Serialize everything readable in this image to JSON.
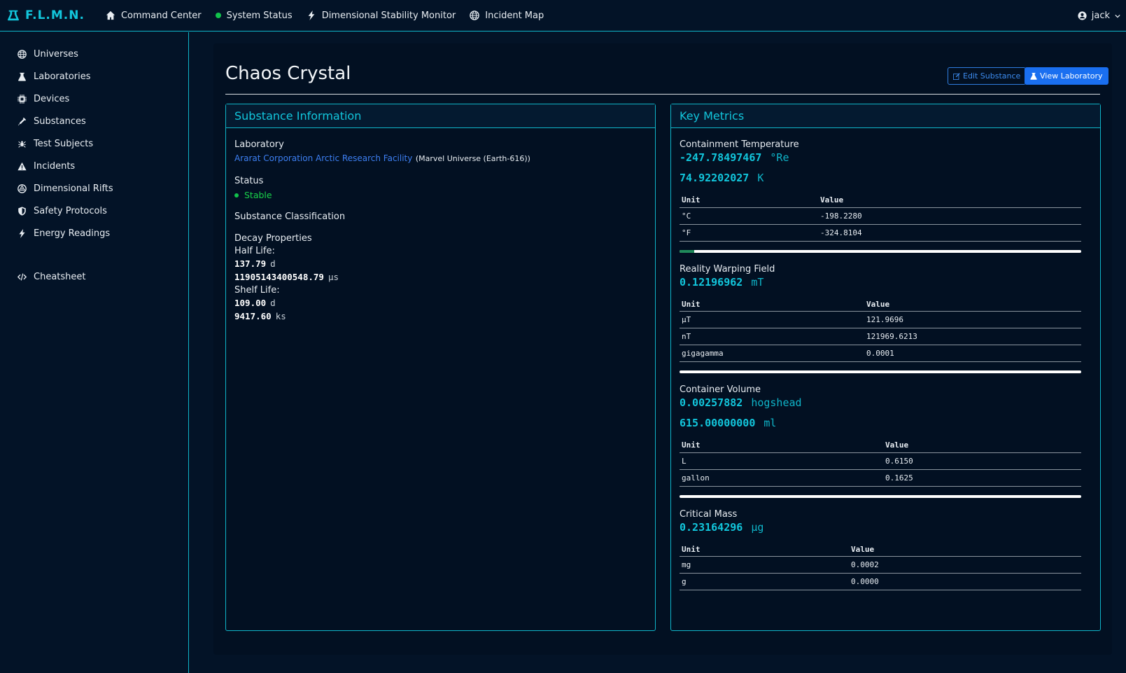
{
  "brand": {
    "name": "F.L.M.N.",
    "icon": "flask-icon"
  },
  "topnav": {
    "links": [
      {
        "label": "Command Center",
        "icon": "home-icon"
      },
      {
        "label": "System Status",
        "icon": "status-dot"
      },
      {
        "label": "Dimensional Stability Monitor",
        "icon": "bolt-icon"
      },
      {
        "label": "Incident Map",
        "icon": "globe-icon"
      }
    ],
    "user": "jack"
  },
  "sidebar": {
    "items": [
      {
        "label": "Universes",
        "icon": "globe-icon"
      },
      {
        "label": "Laboratories",
        "icon": "flask-icon"
      },
      {
        "label": "Devices",
        "icon": "chip-icon"
      },
      {
        "label": "Substances",
        "icon": "syringe-icon"
      },
      {
        "label": "Test Subjects",
        "icon": "spider-icon"
      },
      {
        "label": "Incidents",
        "icon": "warning-icon"
      },
      {
        "label": "Dimensional Rifts",
        "icon": "atom-icon"
      },
      {
        "label": "Safety Protocols",
        "icon": "shield-icon"
      },
      {
        "label": "Energy Readings",
        "icon": "bolt-icon"
      }
    ],
    "cheatsheet": {
      "label": "Cheatsheet",
      "icon": "code-icon"
    }
  },
  "page": {
    "title": "Chaos Crystal",
    "edit_label": "Edit Substance",
    "view_label": "View Laboratory"
  },
  "info": {
    "heading": "Substance Information",
    "laboratory_label": "Laboratory",
    "laboratory_link": "Ararat Corporation Arctic Research Facility",
    "laboratory_universe": "(Marvel Universe (Earth-616))",
    "status_label": "Status",
    "status_value": "Stable",
    "classification_label": "Substance Classification",
    "decay_label": "Decay Properties",
    "half_life_label": "Half Life:",
    "half_life": [
      {
        "value": "137.79",
        "unit": "d"
      },
      {
        "value": "11905143400548.79",
        "unit": "μs"
      }
    ],
    "shelf_life_label": "Shelf Life:",
    "shelf_life": [
      {
        "value": "109.00",
        "unit": "d"
      },
      {
        "value": "9417.60",
        "unit": "ks"
      }
    ]
  },
  "metrics": {
    "heading": "Key Metrics",
    "col_unit": "Unit",
    "col_value": "Value",
    "temperature": {
      "name": "Containment Temperature",
      "primary": [
        {
          "value": "-247.78497467",
          "unit": "°Re"
        },
        {
          "value": "74.92202027",
          "unit": "K"
        }
      ],
      "rows": [
        {
          "unit": "°C",
          "value": "-198.2280"
        },
        {
          "unit": "°F",
          "value": "-324.8104"
        }
      ],
      "progress": 0.037
    },
    "field": {
      "name": "Reality Warping Field",
      "primary": [
        {
          "value": "0.12196962",
          "unit": "mT"
        }
      ],
      "rows": [
        {
          "unit": "μT",
          "value": "121.9696"
        },
        {
          "unit": "nT",
          "value": "121969.6213"
        },
        {
          "unit": "gigagamma",
          "value": "0.0001"
        }
      ],
      "progress": 0
    },
    "volume": {
      "name": "Container Volume",
      "primary": [
        {
          "value": "0.00257882",
          "unit": "hogshead"
        },
        {
          "value": "615.00000000",
          "unit": "ml"
        }
      ],
      "rows": [
        {
          "unit": "L",
          "value": "0.6150"
        },
        {
          "unit": "gallon",
          "value": "0.1625"
        }
      ],
      "progress": 0
    },
    "mass": {
      "name": "Critical Mass",
      "primary": [
        {
          "value": "0.23164296",
          "unit": "μg"
        }
      ],
      "rows": [
        {
          "unit": "mg",
          "value": "0.0002"
        },
        {
          "unit": "g",
          "value": "0.0000"
        }
      ]
    }
  },
  "colors": {
    "accent": "#12c6dc",
    "link": "#3d7ff2",
    "status_ok": "#19d24a",
    "button_primary": "#1a6ff0",
    "background": "#031327"
  }
}
